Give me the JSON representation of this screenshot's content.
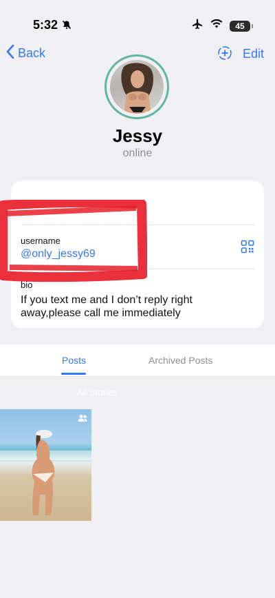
{
  "status": {
    "time": "5:32",
    "battery": "45"
  },
  "nav": {
    "back_label": "Back",
    "edit_label": "Edit"
  },
  "profile": {
    "name": "Jessy",
    "status": "online"
  },
  "info": {
    "username_label": "username",
    "username": "@only_jessy69",
    "bio_label": "bio",
    "bio": "If you text me and I don’t reply right away,please call me immediately"
  },
  "tabs": [
    {
      "label": "Posts",
      "active": true
    },
    {
      "label": "Archived Posts",
      "active": false
    }
  ],
  "ghost_text": "All Stories",
  "posts": [
    {
      "icon": "people-icon"
    }
  ],
  "colors": {
    "accent": "#3478f6",
    "background": "#efeff4",
    "ring": "#5fb89a",
    "annotation": "#e8202a"
  }
}
